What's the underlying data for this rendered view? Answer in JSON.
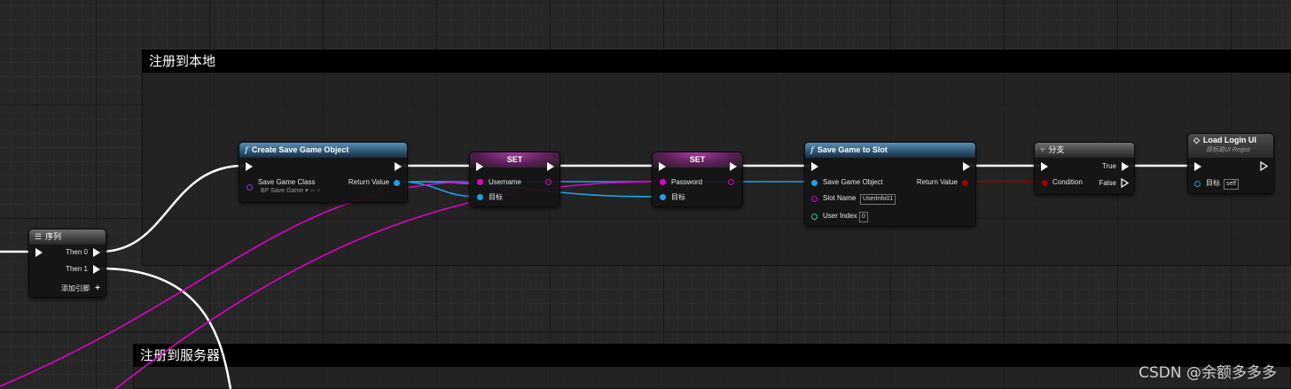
{
  "comments": {
    "local": "注册到本地",
    "server": "注册到服务器"
  },
  "sequence_node": {
    "title": "序列",
    "then0": "Then 0",
    "then1": "Then 1",
    "add_pin": "添加引脚",
    "add_icon": "+"
  },
  "create_save_node": {
    "title": "Create Save Game Object",
    "class_label": "Save Game Class",
    "class_value": "BP Save Game",
    "return_label": "Return Value"
  },
  "set_node_1": {
    "title": "SET",
    "var_label": "Username",
    "target_label": "目标"
  },
  "set_node_2": {
    "title": "SET",
    "var_label": "Password",
    "target_label": "目标"
  },
  "save_slot_node": {
    "title": "Save Game to Slot",
    "object_label": "Save Game Object",
    "slot_label": "Slot Name",
    "slot_value": "UserInfo01",
    "user_label": "User Index",
    "user_value": "0",
    "return_label": "Return Value"
  },
  "branch_node": {
    "title": "分支",
    "condition_label": "Condition",
    "true_label": "True",
    "false_label": "False"
  },
  "load_ui_node": {
    "title": "Load Login UI",
    "subtitle": "目标是UI Regist",
    "target_label": "目标",
    "target_value": "self"
  },
  "watermark": "CSDN @余额多多多",
  "colors": {
    "exec": "#ffffff",
    "object_pin": "#1ea0e6",
    "string_pin": "#e100c8",
    "bool_pin": "#9a0000",
    "int_pin": "#28d29a",
    "class_pin": "#8a3cc8"
  }
}
